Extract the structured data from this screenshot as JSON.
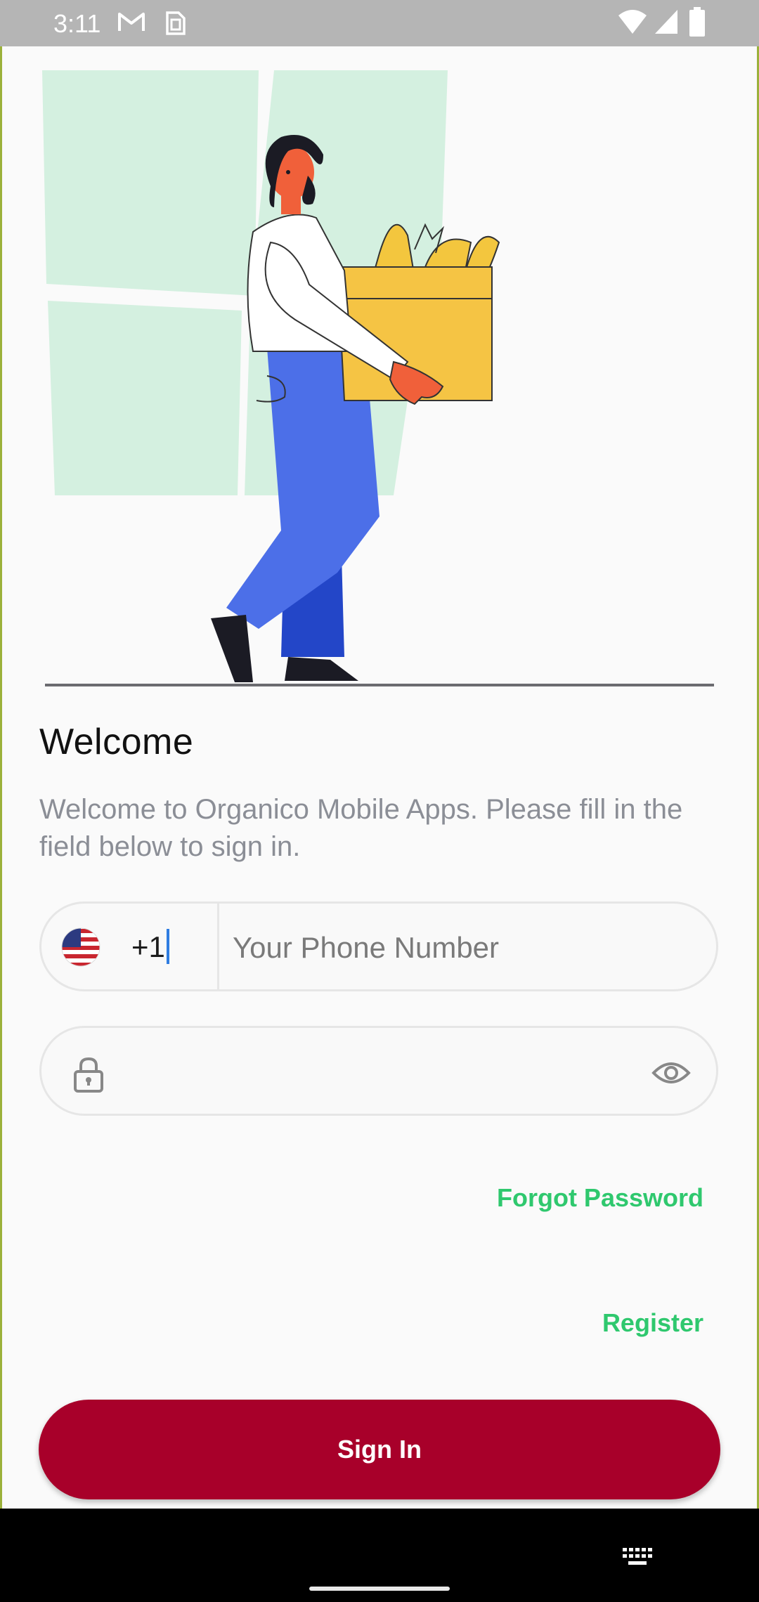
{
  "status_bar": {
    "time": "3:11",
    "icons": [
      "gmail-icon",
      "sim-alert-icon",
      "wifi-icon",
      "signal-icon",
      "battery-icon"
    ]
  },
  "welcome": {
    "title": "Welcome",
    "subtitle": "Welcome to Organico Mobile Apps. Please fill in the field below to sign in."
  },
  "phone": {
    "country_code": "+1",
    "flag": "us-flag-icon",
    "placeholder": "Your Phone Number",
    "value": ""
  },
  "password": {
    "value": "",
    "leading_icon": "lock-icon",
    "trailing_icon": "eye-icon"
  },
  "links": {
    "forgot_password": "Forgot Password",
    "register": "Register"
  },
  "actions": {
    "sign_in": "Sign In"
  },
  "colors": {
    "accent_green": "#2fc86e",
    "primary_button": "#a8002a",
    "status_bar": "#b5b5b5"
  }
}
